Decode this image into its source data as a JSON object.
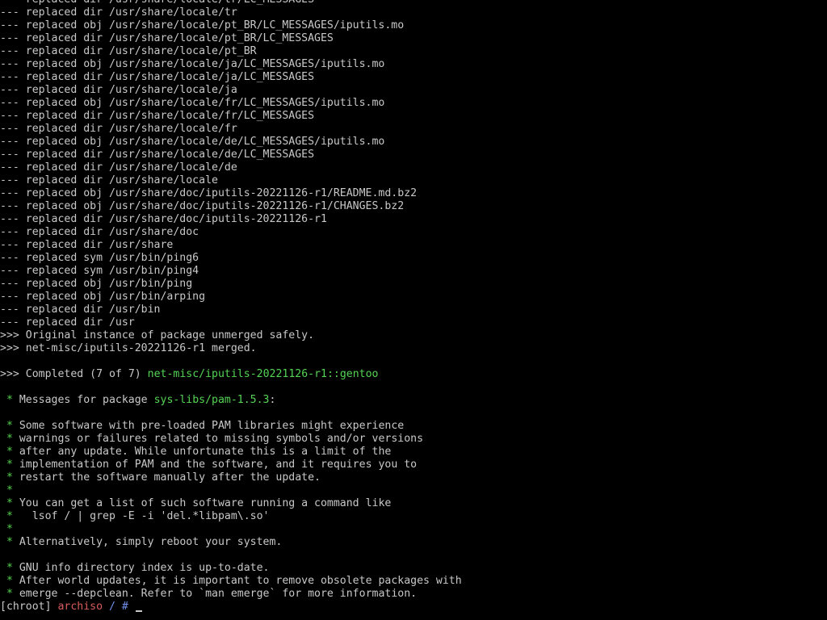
{
  "colors": {
    "background": "#000000",
    "text": "#c8c8c8",
    "green": "#54d354",
    "red": "#d85c5c",
    "blue": "#6f8fe8"
  },
  "replaced_lines": [
    "--- replaced dir /usr/share/locale/tr/LC_MESSAGES",
    "--- replaced dir /usr/share/locale/tr",
    "--- replaced obj /usr/share/locale/pt_BR/LC_MESSAGES/iputils.mo",
    "--- replaced dir /usr/share/locale/pt_BR/LC_MESSAGES",
    "--- replaced dir /usr/share/locale/pt_BR",
    "--- replaced obj /usr/share/locale/ja/LC_MESSAGES/iputils.mo",
    "--- replaced dir /usr/share/locale/ja/LC_MESSAGES",
    "--- replaced dir /usr/share/locale/ja",
    "--- replaced obj /usr/share/locale/fr/LC_MESSAGES/iputils.mo",
    "--- replaced dir /usr/share/locale/fr/LC_MESSAGES",
    "--- replaced dir /usr/share/locale/fr",
    "--- replaced obj /usr/share/locale/de/LC_MESSAGES/iputils.mo",
    "--- replaced dir /usr/share/locale/de/LC_MESSAGES",
    "--- replaced dir /usr/share/locale/de",
    "--- replaced dir /usr/share/locale",
    "--- replaced obj /usr/share/doc/iputils-20221126-r1/README.md.bz2",
    "--- replaced obj /usr/share/doc/iputils-20221126-r1/CHANGES.bz2",
    "--- replaced dir /usr/share/doc/iputils-20221126-r1",
    "--- replaced dir /usr/share/doc",
    "--- replaced dir /usr/share",
    "--- replaced sym /usr/bin/ping6",
    "--- replaced sym /usr/bin/ping4",
    "--- replaced obj /usr/bin/ping",
    "--- replaced obj /usr/bin/arping",
    "--- replaced dir /usr/bin",
    "--- replaced dir /usr"
  ],
  "merge_lines": [
    ">>> Original instance of package unmerged safely.",
    ">>> net-misc/iputils-20221126-r1 merged."
  ],
  "completed": {
    "prefix": ">>> Completed (",
    "current": "7",
    "of": " of ",
    "total": "7",
    "suffix": ") ",
    "package": "net-misc/iputils-20221126-r1::gentoo"
  },
  "messages_header": {
    "star": " *",
    "text": " Messages for package ",
    "package": "sys-libs/pam-1.5.3",
    "colon": ":"
  },
  "pam_messages": [
    " Some software with pre-loaded PAM libraries might experience",
    " warnings or failures related to missing symbols and/or versions",
    " after any update. While unfortunate this is a limit of the",
    " implementation of PAM and the software, and it requires you to",
    " restart the software manually after the update.",
    "",
    " You can get a list of such software running a command like",
    "   lsof / | grep -E -i 'del.*libpam\\.so'",
    "",
    " Alternatively, simply reboot your system."
  ],
  "info_line": " GNU info directory index is up-to-date.",
  "depclean_lines": [
    " After world updates, it is important to remove obsolete packages with",
    " emerge --depclean. Refer to `man emerge` for more information."
  ],
  "prompt": {
    "open": "[chroot] ",
    "host": "archiso",
    "path": " / ",
    "symbol": "#"
  }
}
